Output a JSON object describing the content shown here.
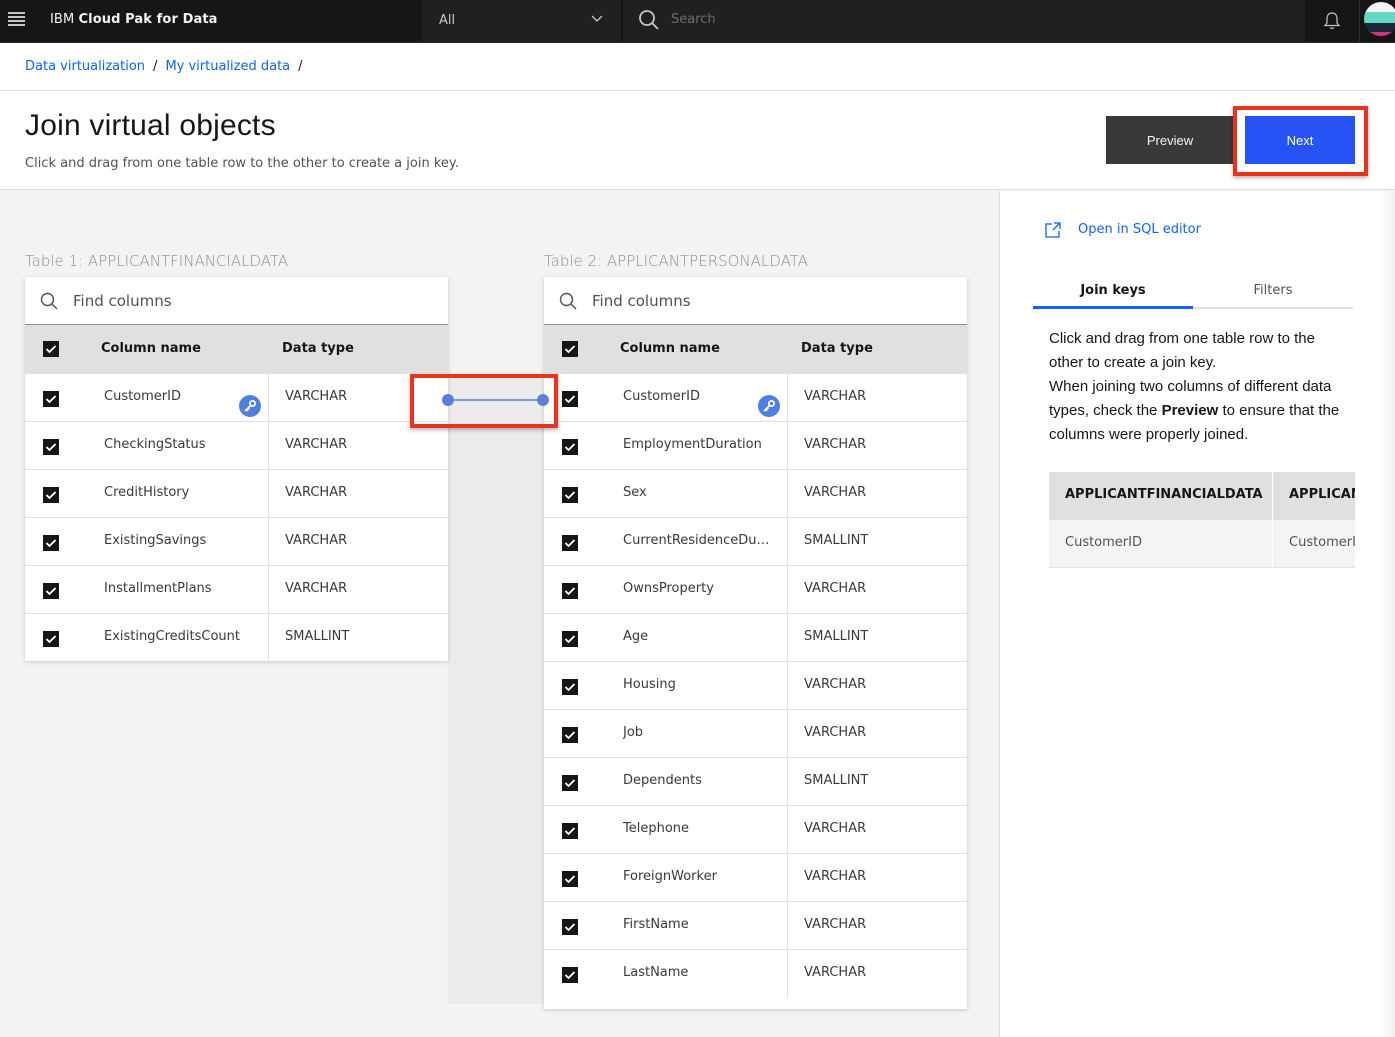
{
  "topbar": {
    "brand_prefix": "IBM",
    "brand_name": "Cloud Pak for Data",
    "scope_value": "All",
    "search_placeholder": "Search"
  },
  "breadcrumb": [
    {
      "label": "Data virtualization"
    },
    {
      "label": "My virtualized data"
    }
  ],
  "breadcrumb_sep": "/",
  "header": {
    "title": "Join virtual objects",
    "subtitle": "Click and drag from one table row to the other to create a join key.",
    "preview_label": "Preview",
    "next_label": "Next"
  },
  "table1": {
    "title": "Table 1: APPLICANTFINANCIALDATA",
    "search_placeholder": "Find columns",
    "headers": {
      "name": "Column name",
      "type": "Data type"
    },
    "rows": [
      {
        "name": "CustomerID",
        "type": "VARCHAR",
        "key": true,
        "checked": true
      },
      {
        "name": "CheckingStatus",
        "type": "VARCHAR",
        "checked": true
      },
      {
        "name": "CreditHistory",
        "type": "VARCHAR",
        "checked": true
      },
      {
        "name": "ExistingSavings",
        "type": "VARCHAR",
        "checked": true
      },
      {
        "name": "InstallmentPlans",
        "type": "VARCHAR",
        "checked": true
      },
      {
        "name": "ExistingCreditsCount",
        "type": "SMALLINT",
        "checked": true
      }
    ]
  },
  "table2": {
    "title": "Table 2: APPLICANTPERSONALDATA",
    "search_placeholder": "Find columns",
    "headers": {
      "name": "Column name",
      "type": "Data type"
    },
    "rows": [
      {
        "name": "CustomerID",
        "type": "VARCHAR",
        "key": true,
        "checked": true
      },
      {
        "name": "EmploymentDuration",
        "type": "VARCHAR",
        "checked": true
      },
      {
        "name": "Sex",
        "type": "VARCHAR",
        "checked": true
      },
      {
        "name": "CurrentResidenceDur...",
        "type": "SMALLINT",
        "checked": true
      },
      {
        "name": "OwnsProperty",
        "type": "VARCHAR",
        "checked": true
      },
      {
        "name": "Age",
        "type": "SMALLINT",
        "checked": true
      },
      {
        "name": "Housing",
        "type": "VARCHAR",
        "checked": true
      },
      {
        "name": "Job",
        "type": "VARCHAR",
        "checked": true
      },
      {
        "name": "Dependents",
        "type": "SMALLINT",
        "checked": true
      },
      {
        "name": "Telephone",
        "type": "VARCHAR",
        "checked": true
      },
      {
        "name": "ForeignWorker",
        "type": "VARCHAR",
        "checked": true
      },
      {
        "name": "FirstName",
        "type": "VARCHAR",
        "checked": true
      },
      {
        "name": "LastName",
        "type": "VARCHAR",
        "checked": true
      }
    ]
  },
  "join": {
    "from": "CustomerID",
    "to": "CustomerID",
    "color": "#5a7fd6"
  },
  "panel": {
    "sql_link": "Open in SQL editor",
    "tabs": [
      {
        "label": "Join keys",
        "active": true
      },
      {
        "label": "Filters",
        "active": false
      }
    ],
    "text_1": "Click and drag from one table row to the other to create a join key.",
    "text_2a": "When joining two columns of different data types, check the ",
    "text_2b": "Preview",
    "text_2c": " to ensure that the columns were properly joined.",
    "keys_table": {
      "headers": [
        "APPLICANTFINANCIALDATA",
        "APPLICANTPERSONALDATA"
      ],
      "rows": [
        [
          "CustomerID",
          "CustomerID"
        ]
      ]
    }
  },
  "colors": {
    "primary": "#0f62fe",
    "next_button": "#2752f5",
    "highlight": "#e8341c",
    "key_badge": "#4f7fe0"
  }
}
